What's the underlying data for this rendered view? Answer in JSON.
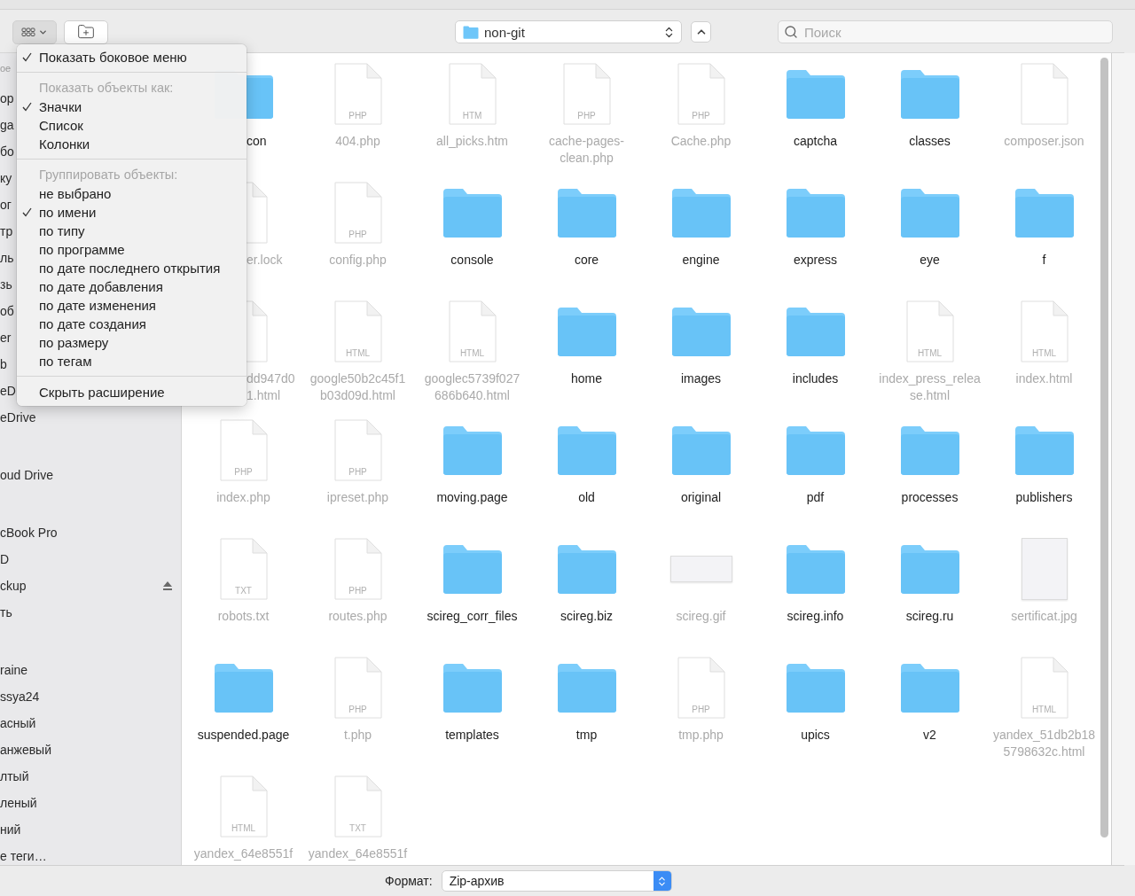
{
  "toolbar": {
    "view_button": {
      "pressed": true
    },
    "path": "non-git",
    "search": {
      "placeholder": "Поиск"
    }
  },
  "sidebar": {
    "sections": [
      {
        "header": "ое",
        "items": [
          {
            "label": "ор"
          },
          {
            "label": "ga"
          },
          {
            "label": "бо"
          },
          {
            "label": "ку"
          },
          {
            "label": "ог"
          },
          {
            "label": "тр"
          },
          {
            "label": "ль"
          },
          {
            "label": "зь"
          },
          {
            "label": "об"
          },
          {
            "label": "er"
          },
          {
            "label": "b"
          },
          {
            "label": "eD"
          },
          {
            "label": "eDrive"
          }
        ]
      },
      {
        "items": [
          {
            "label": "oud Drive"
          }
        ]
      },
      {
        "items": [
          {
            "label": "cBook Pro"
          },
          {
            "label": "D"
          },
          {
            "label": "ckup",
            "eject": true
          },
          {
            "label": "ть"
          }
        ]
      },
      {
        "items": [
          {
            "label": "raine"
          },
          {
            "label": "ssya24"
          },
          {
            "label": "асный"
          },
          {
            "label": "анжевый"
          },
          {
            "label": "лтый"
          },
          {
            "label": "леный"
          },
          {
            "label": "ний"
          },
          {
            "label": "е теги…"
          }
        ]
      }
    ]
  },
  "files": [
    {
      "kind": "folder",
      "lines": [
        "con"
      ],
      "cut": true,
      "disabled": false
    },
    {
      "kind": "document",
      "badge": "PHP",
      "lines": [
        "404.php"
      ],
      "disabled": true
    },
    {
      "kind": "document",
      "badge": "HTM",
      "lines": [
        "all_picks.htm"
      ],
      "disabled": true
    },
    {
      "kind": "document",
      "badge": "PHP",
      "lines": [
        "cache-pages-",
        "clean.php"
      ],
      "disabled": true
    },
    {
      "kind": "document",
      "badge": "PHP",
      "lines": [
        "Cache.php"
      ],
      "disabled": true
    },
    {
      "kind": "folder",
      "lines": [
        "captcha"
      ],
      "disabled": false
    },
    {
      "kind": "folder",
      "lines": [
        "classes"
      ],
      "disabled": false
    },
    {
      "kind": "document",
      "lines": [
        "composer.json"
      ],
      "disabled": true
    },
    {
      "kind": "document",
      "lines": [
        "er.lock"
      ],
      "cut": true,
      "disabled": true
    },
    {
      "kind": "document",
      "badge": "PHP",
      "lines": [
        "config.php"
      ],
      "disabled": true
    },
    {
      "kind": "folder",
      "lines": [
        "console"
      ],
      "disabled": false
    },
    {
      "kind": "folder",
      "lines": [
        "core"
      ],
      "disabled": false
    },
    {
      "kind": "folder",
      "lines": [
        "engine"
      ],
      "disabled": false
    },
    {
      "kind": "folder",
      "lines": [
        "express"
      ],
      "disabled": false
    },
    {
      "kind": "folder",
      "lines": [
        "eye"
      ],
      "disabled": false
    },
    {
      "kind": "folder",
      "lines": [
        "f"
      ],
      "disabled": false
    },
    {
      "kind": "document",
      "lines": [
        "dd947d0",
        "1.html"
      ],
      "cut": true,
      "disabled": true
    },
    {
      "kind": "document",
      "badge": "HTML",
      "lines": [
        "google50b2c45f1",
        "b03d09d.html"
      ],
      "disabled": true
    },
    {
      "kind": "document",
      "badge": "HTML",
      "lines": [
        "googlec5739f027",
        "686b640.html"
      ],
      "disabled": true
    },
    {
      "kind": "folder",
      "lines": [
        "home"
      ],
      "disabled": false
    },
    {
      "kind": "folder",
      "lines": [
        "images"
      ],
      "disabled": false
    },
    {
      "kind": "folder",
      "lines": [
        "includes"
      ],
      "disabled": false
    },
    {
      "kind": "document",
      "badge": "HTML",
      "lines": [
        "index_press_relea",
        "se.html"
      ],
      "disabled": true
    },
    {
      "kind": "document",
      "badge": "HTML",
      "lines": [
        "index.html"
      ],
      "disabled": true
    },
    {
      "kind": "document",
      "badge": "PHP",
      "lines": [
        "index.php"
      ],
      "disabled": true
    },
    {
      "kind": "document",
      "badge": "PHP",
      "lines": [
        "ipreset.php"
      ],
      "disabled": true
    },
    {
      "kind": "folder",
      "lines": [
        "moving.page"
      ],
      "disabled": false
    },
    {
      "kind": "folder",
      "lines": [
        "old"
      ],
      "disabled": false
    },
    {
      "kind": "folder",
      "lines": [
        "original"
      ],
      "disabled": false
    },
    {
      "kind": "folder",
      "lines": [
        "pdf"
      ],
      "disabled": false
    },
    {
      "kind": "folder",
      "lines": [
        "processes"
      ],
      "disabled": false
    },
    {
      "kind": "folder",
      "lines": [
        "publishers"
      ],
      "disabled": false
    },
    {
      "kind": "document",
      "badge": "TXT",
      "lines": [
        "robots.txt"
      ],
      "disabled": true
    },
    {
      "kind": "document",
      "badge": "PHP",
      "lines": [
        "routes.php"
      ],
      "disabled": true
    },
    {
      "kind": "folder",
      "lines": [
        "scireg_corr_files"
      ],
      "disabled": false
    },
    {
      "kind": "folder",
      "lines": [
        "scireg.biz"
      ],
      "disabled": false
    },
    {
      "kind": "image",
      "wide": true,
      "lines": [
        "scireg.gif"
      ],
      "disabled": true
    },
    {
      "kind": "folder",
      "lines": [
        "scireg.info"
      ],
      "disabled": false
    },
    {
      "kind": "folder",
      "lines": [
        "scireg.ru"
      ],
      "disabled": false
    },
    {
      "kind": "image",
      "wide": false,
      "lines": [
        "sertificat.jpg"
      ],
      "disabled": true
    },
    {
      "kind": "folder",
      "lines": [
        "suspended.page"
      ],
      "disabled": false
    },
    {
      "kind": "document",
      "badge": "PHP",
      "lines": [
        "t.php"
      ],
      "disabled": true
    },
    {
      "kind": "folder",
      "lines": [
        "templates"
      ],
      "disabled": false
    },
    {
      "kind": "folder",
      "lines": [
        "tmp"
      ],
      "disabled": false
    },
    {
      "kind": "document",
      "badge": "PHP",
      "lines": [
        "tmp.php"
      ],
      "disabled": true
    },
    {
      "kind": "folder",
      "lines": [
        "upics"
      ],
      "disabled": false
    },
    {
      "kind": "folder",
      "lines": [
        "v2"
      ],
      "disabled": false
    },
    {
      "kind": "document",
      "badge": "HTML",
      "lines": [
        "yandex_51db2b18",
        "5798632c.html"
      ],
      "disabled": true
    },
    {
      "kind": "document",
      "badge": "HTML",
      "lines": [
        "yandex_64e8551f"
      ],
      "disabled": true
    },
    {
      "kind": "document",
      "badge": "TXT",
      "lines": [
        "yandex_64e8551f"
      ],
      "disabled": true
    }
  ],
  "view_menu": {
    "items": [
      {
        "kind": "item",
        "label": "Показать боковое меню",
        "checked": true
      },
      {
        "kind": "separator"
      },
      {
        "kind": "header",
        "label": "Показать объекты как:"
      },
      {
        "kind": "item",
        "label": "Значки",
        "checked": true
      },
      {
        "kind": "item",
        "label": "Список",
        "checked": false
      },
      {
        "kind": "item",
        "label": "Колонки",
        "checked": false
      },
      {
        "kind": "separator"
      },
      {
        "kind": "header",
        "label": "Группировать объекты:"
      },
      {
        "kind": "item",
        "label": "не выбрано",
        "checked": false
      },
      {
        "kind": "item",
        "label": "по имени",
        "checked": true
      },
      {
        "kind": "item",
        "label": "по типу",
        "checked": false
      },
      {
        "kind": "item",
        "label": "по программе",
        "checked": false
      },
      {
        "kind": "item",
        "label": "по дате последнего открытия",
        "checked": false
      },
      {
        "kind": "item",
        "label": "по дате добавления",
        "checked": false
      },
      {
        "kind": "item",
        "label": "по дате изменения",
        "checked": false
      },
      {
        "kind": "item",
        "label": "по дате создания",
        "checked": false
      },
      {
        "kind": "item",
        "label": "по размеру",
        "checked": false
      },
      {
        "kind": "item",
        "label": "по тегам",
        "checked": false
      },
      {
        "kind": "separator"
      },
      {
        "kind": "item",
        "label": "Скрыть расширение",
        "checked": false
      }
    ]
  },
  "footer": {
    "format_label": "Формат:",
    "format_value": "Zip-архив"
  }
}
